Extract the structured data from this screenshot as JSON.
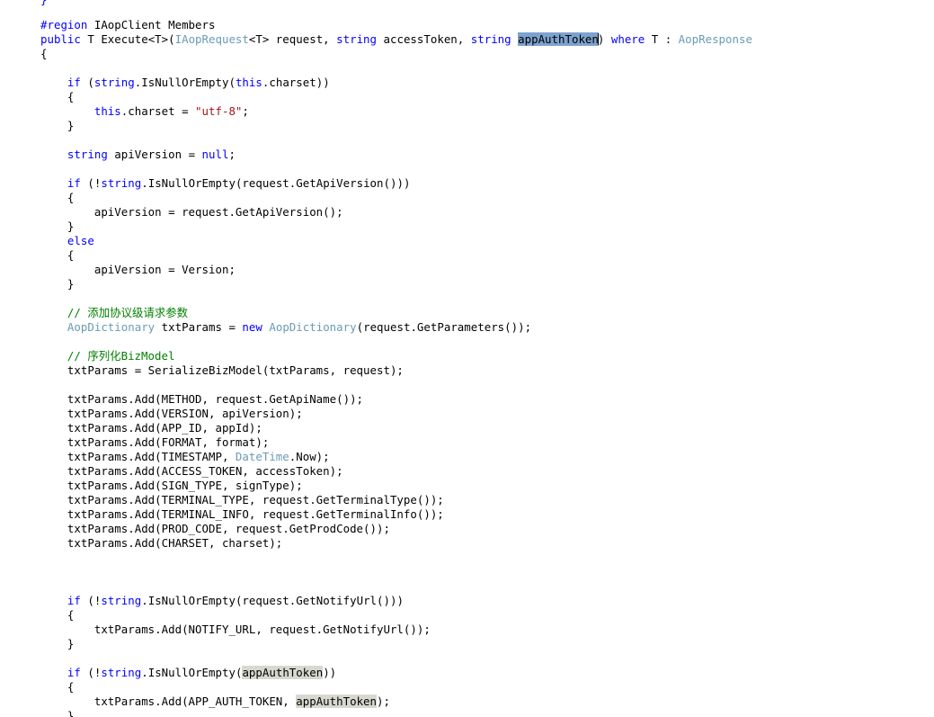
{
  "editor": {
    "language": "csharp",
    "theme": "visual-studio-light",
    "background_color": "#ffffff",
    "font_size_px": 12.4,
    "line_height_px": 16,
    "colors": {
      "keyword": "#0000ff",
      "type": "#6a9bb5",
      "string": "#a31515",
      "comment": "#008000",
      "plain_text": "#000000",
      "selection_highlight": "#7da2ce",
      "reference_highlight": "#d8d8d0"
    },
    "clipped_top_fragment": "}"
  },
  "selection": {
    "selected_text": "appAuthToken",
    "occurrences_highlighted": 3
  },
  "code": {
    "lines": [
      {
        "indent": 0,
        "tokens": [
          {
            "t": "#region",
            "c": "region"
          },
          {
            "t": " IAopClient Members",
            "c": "plain"
          }
        ]
      },
      {
        "indent": 0,
        "tokens": [
          {
            "t": "public",
            "c": "kw"
          },
          {
            "t": " T Execute<T>(",
            "c": "plain"
          },
          {
            "t": "IAopRequest",
            "c": "type"
          },
          {
            "t": "<T> request, ",
            "c": "plain"
          },
          {
            "t": "string",
            "c": "kw"
          },
          {
            "t": " accessToken, ",
            "c": "plain"
          },
          {
            "t": "string",
            "c": "kw"
          },
          {
            "t": " ",
            "c": "plain"
          },
          {
            "t": "appAuthToken",
            "c": "sel"
          },
          {
            "t": "|",
            "c": "caret"
          },
          {
            "t": ") ",
            "c": "plain"
          },
          {
            "t": "where",
            "c": "kw"
          },
          {
            "t": " T : ",
            "c": "plain"
          },
          {
            "t": "AopResponse",
            "c": "type"
          }
        ]
      },
      {
        "indent": 0,
        "tokens": [
          {
            "t": "{",
            "c": "plain"
          }
        ]
      },
      {
        "indent": 0,
        "tokens": [
          {
            "t": "",
            "c": "plain"
          }
        ]
      },
      {
        "indent": 1,
        "tokens": [
          {
            "t": "if",
            "c": "kw"
          },
          {
            "t": " (",
            "c": "plain"
          },
          {
            "t": "string",
            "c": "kw"
          },
          {
            "t": ".IsNullOrEmpty(",
            "c": "plain"
          },
          {
            "t": "this",
            "c": "kw"
          },
          {
            "t": ".charset))",
            "c": "plain"
          }
        ]
      },
      {
        "indent": 1,
        "tokens": [
          {
            "t": "{",
            "c": "plain"
          }
        ]
      },
      {
        "indent": 2,
        "tokens": [
          {
            "t": "this",
            "c": "kw"
          },
          {
            "t": ".charset = ",
            "c": "plain"
          },
          {
            "t": "\"utf-8\"",
            "c": "str"
          },
          {
            "t": ";",
            "c": "plain"
          }
        ]
      },
      {
        "indent": 1,
        "tokens": [
          {
            "t": "}",
            "c": "plain"
          }
        ]
      },
      {
        "indent": 0,
        "tokens": [
          {
            "t": "",
            "c": "plain"
          }
        ]
      },
      {
        "indent": 1,
        "tokens": [
          {
            "t": "string",
            "c": "kw"
          },
          {
            "t": " apiVersion = ",
            "c": "plain"
          },
          {
            "t": "null",
            "c": "kw"
          },
          {
            "t": ";",
            "c": "plain"
          }
        ]
      },
      {
        "indent": 0,
        "tokens": [
          {
            "t": "",
            "c": "plain"
          }
        ]
      },
      {
        "indent": 1,
        "tokens": [
          {
            "t": "if",
            "c": "kw"
          },
          {
            "t": " (!",
            "c": "plain"
          },
          {
            "t": "string",
            "c": "kw"
          },
          {
            "t": ".IsNullOrEmpty(request.GetApiVersion()))",
            "c": "plain"
          }
        ]
      },
      {
        "indent": 1,
        "tokens": [
          {
            "t": "{",
            "c": "plain"
          }
        ]
      },
      {
        "indent": 2,
        "tokens": [
          {
            "t": "apiVersion = request.GetApiVersion();",
            "c": "plain"
          }
        ]
      },
      {
        "indent": 1,
        "tokens": [
          {
            "t": "}",
            "c": "plain"
          }
        ]
      },
      {
        "indent": 1,
        "tokens": [
          {
            "t": "else",
            "c": "kw"
          }
        ]
      },
      {
        "indent": 1,
        "tokens": [
          {
            "t": "{",
            "c": "plain"
          }
        ]
      },
      {
        "indent": 2,
        "tokens": [
          {
            "t": "apiVersion = Version;",
            "c": "plain"
          }
        ]
      },
      {
        "indent": 1,
        "tokens": [
          {
            "t": "}",
            "c": "plain"
          }
        ]
      },
      {
        "indent": 0,
        "tokens": [
          {
            "t": "",
            "c": "plain"
          }
        ]
      },
      {
        "indent": 1,
        "tokens": [
          {
            "t": "// 添加协议级请求参数",
            "c": "cmt"
          }
        ]
      },
      {
        "indent": 1,
        "tokens": [
          {
            "t": "AopDictionary",
            "c": "type"
          },
          {
            "t": " txtParams = ",
            "c": "plain"
          },
          {
            "t": "new",
            "c": "kw"
          },
          {
            "t": " ",
            "c": "plain"
          },
          {
            "t": "AopDictionary",
            "c": "type"
          },
          {
            "t": "(request.GetParameters());",
            "c": "plain"
          }
        ]
      },
      {
        "indent": 0,
        "tokens": [
          {
            "t": "",
            "c": "plain"
          }
        ]
      },
      {
        "indent": 1,
        "tokens": [
          {
            "t": "// 序列化BizModel",
            "c": "cmt"
          }
        ]
      },
      {
        "indent": 1,
        "tokens": [
          {
            "t": "txtParams = SerializeBizModel(txtParams, request);",
            "c": "plain"
          }
        ]
      },
      {
        "indent": 0,
        "tokens": [
          {
            "t": "",
            "c": "plain"
          }
        ]
      },
      {
        "indent": 1,
        "tokens": [
          {
            "t": "txtParams.Add(METHOD, request.GetApiName());",
            "c": "plain"
          }
        ]
      },
      {
        "indent": 1,
        "tokens": [
          {
            "t": "txtParams.Add(VERSION, apiVersion);",
            "c": "plain"
          }
        ]
      },
      {
        "indent": 1,
        "tokens": [
          {
            "t": "txtParams.Add(APP_ID, appId);",
            "c": "plain"
          }
        ]
      },
      {
        "indent": 1,
        "tokens": [
          {
            "t": "txtParams.Add(FORMAT, format);",
            "c": "plain"
          }
        ]
      },
      {
        "indent": 1,
        "tokens": [
          {
            "t": "txtParams.Add(TIMESTAMP, ",
            "c": "plain"
          },
          {
            "t": "DateTime",
            "c": "type"
          },
          {
            "t": ".Now);",
            "c": "plain"
          }
        ]
      },
      {
        "indent": 1,
        "tokens": [
          {
            "t": "txtParams.Add(ACCESS_TOKEN, accessToken);",
            "c": "plain"
          }
        ]
      },
      {
        "indent": 1,
        "tokens": [
          {
            "t": "txtParams.Add(SIGN_TYPE, signType);",
            "c": "plain"
          }
        ]
      },
      {
        "indent": 1,
        "tokens": [
          {
            "t": "txtParams.Add(TERMINAL_TYPE, request.GetTerminalType());",
            "c": "plain"
          }
        ]
      },
      {
        "indent": 1,
        "tokens": [
          {
            "t": "txtParams.Add(TERMINAL_INFO, request.GetTerminalInfo());",
            "c": "plain"
          }
        ]
      },
      {
        "indent": 1,
        "tokens": [
          {
            "t": "txtParams.Add(PROD_CODE, request.GetProdCode());",
            "c": "plain"
          }
        ]
      },
      {
        "indent": 1,
        "tokens": [
          {
            "t": "txtParams.Add(CHARSET, charset);",
            "c": "plain"
          }
        ]
      },
      {
        "indent": 0,
        "tokens": [
          {
            "t": "",
            "c": "plain"
          }
        ]
      },
      {
        "indent": 0,
        "tokens": [
          {
            "t": "",
            "c": "plain"
          }
        ]
      },
      {
        "indent": 0,
        "tokens": [
          {
            "t": "",
            "c": "plain"
          }
        ]
      },
      {
        "indent": 1,
        "tokens": [
          {
            "t": "if",
            "c": "kw"
          },
          {
            "t": " (!",
            "c": "plain"
          },
          {
            "t": "string",
            "c": "kw"
          },
          {
            "t": ".IsNullOrEmpty(request.GetNotifyUrl()))",
            "c": "plain"
          }
        ]
      },
      {
        "indent": 1,
        "tokens": [
          {
            "t": "{",
            "c": "plain"
          }
        ]
      },
      {
        "indent": 2,
        "tokens": [
          {
            "t": "txtParams.Add(NOTIFY_URL, request.GetNotifyUrl());",
            "c": "plain"
          }
        ]
      },
      {
        "indent": 1,
        "tokens": [
          {
            "t": "}",
            "c": "plain"
          }
        ]
      },
      {
        "indent": 0,
        "tokens": [
          {
            "t": "",
            "c": "plain"
          }
        ]
      },
      {
        "indent": 1,
        "tokens": [
          {
            "t": "if",
            "c": "kw"
          },
          {
            "t": " (!",
            "c": "plain"
          },
          {
            "t": "string",
            "c": "kw"
          },
          {
            "t": ".IsNullOrEmpty(",
            "c": "plain"
          },
          {
            "t": "appAuthToken",
            "c": "ref"
          },
          {
            "t": "))",
            "c": "plain"
          }
        ]
      },
      {
        "indent": 1,
        "tokens": [
          {
            "t": "{",
            "c": "plain"
          }
        ]
      },
      {
        "indent": 2,
        "tokens": [
          {
            "t": "txtParams.Add(APP_AUTH_TOKEN, ",
            "c": "plain"
          },
          {
            "t": "appAuthToken",
            "c": "ref"
          },
          {
            "t": ");",
            "c": "plain"
          }
        ]
      },
      {
        "indent": 1,
        "tokens": [
          {
            "t": "}",
            "c": "plain"
          }
        ]
      }
    ]
  }
}
